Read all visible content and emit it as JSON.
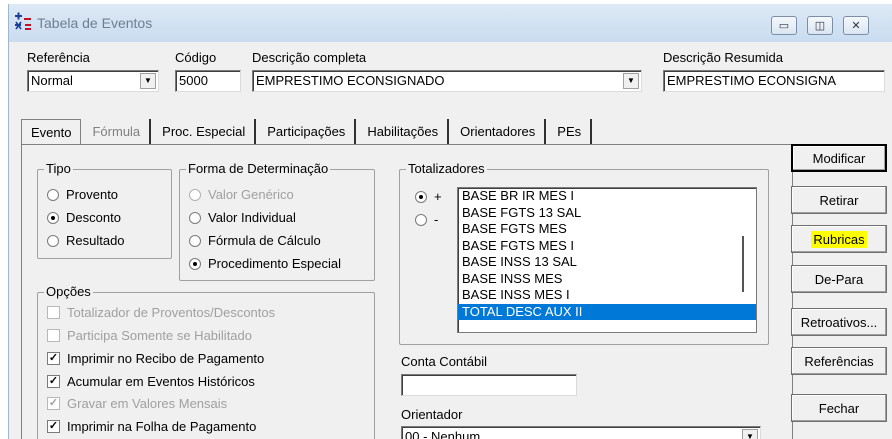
{
  "window": {
    "title": "Tabela de Eventos",
    "minimize": "▭",
    "restore": "◫",
    "close": "✕"
  },
  "header": {
    "referencia": {
      "label": "Referência",
      "value": "Normal"
    },
    "codigo": {
      "label": "Código",
      "value": "5000"
    },
    "descricao_completa": {
      "label": "Descrição completa",
      "value": "EMPRESTIMO ECONSIGNADO"
    },
    "descricao_resumida": {
      "label": "Descrição Resumida",
      "value": "EMPRESTIMO ECONSIGNA"
    }
  },
  "tabs": [
    {
      "label": "Evento"
    },
    {
      "label": "Fórmula"
    },
    {
      "label": "Proc. Especial"
    },
    {
      "label": "Participações"
    },
    {
      "label": "Habilitações"
    },
    {
      "label": "Orientadores"
    },
    {
      "label": "PEs"
    }
  ],
  "tipo": {
    "title": "Tipo",
    "options": [
      {
        "label": "Provento",
        "checked": false
      },
      {
        "label": "Desconto",
        "checked": true
      },
      {
        "label": "Resultado",
        "checked": false
      }
    ]
  },
  "forma": {
    "title": "Forma de Determinação",
    "options": [
      {
        "label": "Valor Genérico",
        "checked": false
      },
      {
        "label": "Valor Individual",
        "checked": false
      },
      {
        "label": "Fórmula de Cálculo",
        "checked": false
      },
      {
        "label": "Procedimento Especial",
        "checked": true
      }
    ]
  },
  "opcoes": {
    "title": "Opções",
    "items": [
      {
        "label": "Totalizador de Proventos/Descontos",
        "checked": false
      },
      {
        "label": "Participa Somente se Habilitado",
        "checked": false
      },
      {
        "label": "Imprimir no Recibo de Pagamento",
        "checked": true
      },
      {
        "label": "Acumular em Eventos Históricos",
        "checked": true
      },
      {
        "label": "Gravar em Valores Mensais",
        "checked": true
      },
      {
        "label": "Imprimir na Folha de Pagamento",
        "checked": true
      }
    ]
  },
  "totalizadores": {
    "title": "Totalizadores",
    "plus": "+",
    "minus": "-",
    "items": [
      "BASE BR IR MES I",
      "BASE FGTS 13 SAL",
      "BASE FGTS MES",
      "BASE FGTS MES I",
      "BASE INSS 13 SAL",
      "BASE INSS MES",
      "BASE INSS MES I",
      "TOTAL DESC AUX II"
    ],
    "selected": "TOTAL DESC AUX II"
  },
  "conta_contabil": {
    "label": "Conta Contábil",
    "value": ""
  },
  "orientador": {
    "label": "Orientador",
    "value": "00 - Nenhum"
  },
  "buttons": {
    "modificar": "Modificar",
    "retirar": "Retirar",
    "rubricas": "Rubricas",
    "de_para": "De-Para",
    "retroativos": "Retroativos...",
    "referencias": "Referências",
    "fechar": "Fechar"
  },
  "colors": {
    "selection": "#0078d7",
    "highlight": "#ffff00"
  },
  "icons": {
    "app": "plus-minus-icon",
    "dropdown": "chevron-down-icon"
  }
}
